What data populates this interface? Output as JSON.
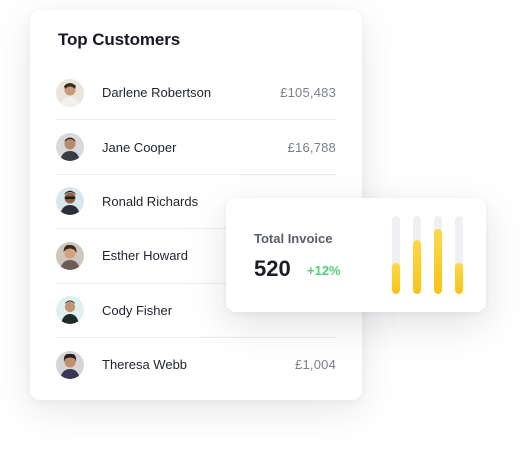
{
  "customers_card": {
    "title": "Top Customers",
    "customers": [
      {
        "name": "Darlene Robertson",
        "amount": "£105,483",
        "avatar_icon": "person-avatar-icon"
      },
      {
        "name": "Jane Cooper",
        "amount": "£16,788",
        "avatar_icon": "person-avatar-icon"
      },
      {
        "name": "Ronald Richards",
        "amount": "",
        "avatar_icon": "person-avatar-icon"
      },
      {
        "name": "Esther Howard",
        "amount": "",
        "avatar_icon": "person-avatar-icon"
      },
      {
        "name": "Cody Fisher",
        "amount": "",
        "avatar_icon": "person-avatar-icon"
      },
      {
        "name": "Theresa Webb",
        "amount": "£1,004",
        "avatar_icon": "person-avatar-icon"
      }
    ]
  },
  "invoice_card": {
    "label": "Total Invoice",
    "value": "520",
    "change": "+12%",
    "bar_levels": [
      0.4,
      0.69,
      0.83,
      0.4
    ],
    "bar_color": "#f7c316",
    "change_color": "#4fcf7a"
  }
}
